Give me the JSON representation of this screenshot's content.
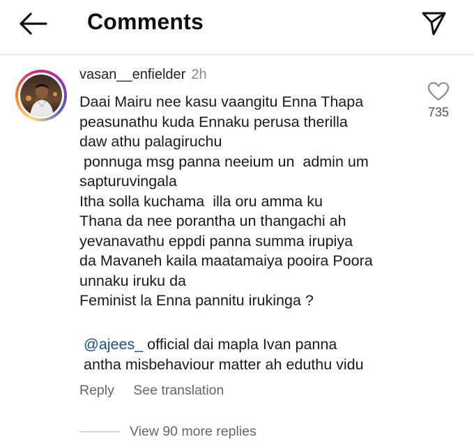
{
  "header": {
    "title": "Comments",
    "back_icon": "arrow-left-icon",
    "send_icon": "paper-plane-icon"
  },
  "comment": {
    "username": "vasan__enfielder",
    "time": "2h",
    "text": "Daai Mairu nee kasu vaangitu Enna Thapa\npeasunathu kuda Ennaku perusa therilla\ndaw athu palagiruchu\n ponnuga msg panna neeium un  admin um\nsapturuvingala\nItha solla kuchama  illa oru amma ku\nThana da nee porantha un thangachi ah\nyevanavathu eppdi panna summa irupiya\nda Mavaneh kaila maatamaiya pooira Poora\nunnaku iruku da\nFeminist la Enna pannitu irukinga ?",
    "mention": "@ajees_",
    "mention_rest": " official dai mapla Ivan panna",
    "mention_line2": "antha misbehaviour matter ah eduthu vidu",
    "likes": "735",
    "like_icon": "heart-outline-icon",
    "reply_label": "Reply",
    "translate_label": "See translation"
  },
  "replies": {
    "label": "View 90 more replies"
  },
  "colors": {
    "mention": "#1a4d8c",
    "muted": "#8a8a8a",
    "text": "#1a1a1a"
  }
}
